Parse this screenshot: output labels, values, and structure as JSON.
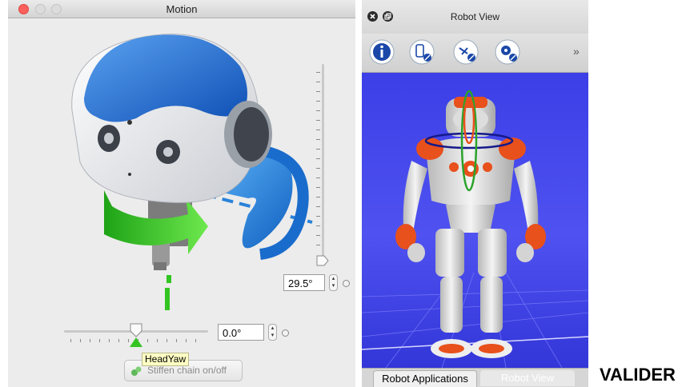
{
  "motion_window": {
    "title": "Motion",
    "pitch_value": "29.5°",
    "yaw_value": "0.0°",
    "tooltip": "HeadYaw",
    "stiffen_label": "Stiffen chain on/off"
  },
  "robot_view_window": {
    "title": "Robot View",
    "toolbar": {
      "icons": [
        "info-icon",
        "joint-icon",
        "tool-icon",
        "settings-icon"
      ],
      "more": "»"
    },
    "tabs": [
      "Robot Applications",
      "Robot View"
    ],
    "active_tab": "Robot View"
  },
  "caption": "VALIDER",
  "colors": {
    "viewport_blue": "#3a3de0",
    "robot_orange": "#e8501c",
    "nao_blue": "#1f6fd6",
    "arrow_green": "#32c522",
    "arrow_blue": "#2a82d8"
  }
}
